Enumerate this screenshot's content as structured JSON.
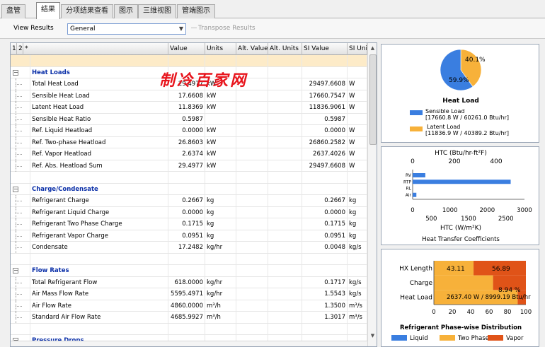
{
  "tabs": [
    {
      "label": "盘管",
      "left": 2
    },
    {
      "label": "结果",
      "left": 51,
      "active": true
    },
    {
      "label": "分项结果查看",
      "left": 86
    },
    {
      "label": "图示",
      "left": 161
    },
    {
      "label": "三维视图",
      "left": 195
    },
    {
      "label": "管端图示",
      "left": 250
    }
  ],
  "toolbar": {
    "view_label": "View Results",
    "view_value": "General",
    "transpose_label": "Transpose Results"
  },
  "grid": {
    "columns": [
      "1",
      "2",
      "*",
      "Value",
      "Units",
      "Alt. Value",
      "Alt. Units",
      "SI Value",
      "SI Uni"
    ],
    "rows": [
      {
        "type": "blank"
      },
      {
        "type": "group",
        "name": "Heat Loads"
      },
      {
        "type": "item",
        "name": "Total Heat Load",
        "value": "29.4977",
        "unit": "kW",
        "si": "29497.6608",
        "siu": "W"
      },
      {
        "type": "item",
        "name": "Sensible Heat Load",
        "value": "17.6608",
        "unit": "kW",
        "si": "17660.7547",
        "siu": "W"
      },
      {
        "type": "item",
        "name": "Latent Heat Load",
        "value": "11.8369",
        "unit": "kW",
        "si": "11836.9061",
        "siu": "W"
      },
      {
        "type": "item",
        "name": "Sensible Heat Ratio",
        "value": "0.5987",
        "unit": "",
        "si": "0.5987",
        "siu": ""
      },
      {
        "type": "item",
        "name": "Ref. Liquid Heatload",
        "value": "0.0000",
        "unit": "kW",
        "si": "0.0000",
        "siu": "W"
      },
      {
        "type": "item",
        "name": "Ref. Two-phase Heatload",
        "value": "26.8603",
        "unit": "kW",
        "si": "26860.2582",
        "siu": "W"
      },
      {
        "type": "item",
        "name": "Ref. Vapor Heatload",
        "value": "2.6374",
        "unit": "kW",
        "si": "2637.4026",
        "siu": "W"
      },
      {
        "type": "item",
        "name": "Ref. Abs. Heatload Sum",
        "value": "29.4977",
        "unit": "kW",
        "si": "29497.6608",
        "siu": "W"
      },
      {
        "type": "blank"
      },
      {
        "type": "group",
        "name": "Charge/Condensate"
      },
      {
        "type": "item",
        "name": "Refrigerant Charge",
        "value": "0.2667",
        "unit": "kg",
        "si": "0.2667",
        "siu": "kg"
      },
      {
        "type": "item",
        "name": "Refrigerant Liquid Charge",
        "value": "0.0000",
        "unit": "kg",
        "si": "0.0000",
        "siu": "kg"
      },
      {
        "type": "item",
        "name": "Refrigerant Two Phase Charge",
        "value": "0.1715",
        "unit": "kg",
        "si": "0.1715",
        "siu": "kg"
      },
      {
        "type": "item",
        "name": "Refrigerant Vapor Charge",
        "value": "0.0951",
        "unit": "kg",
        "si": "0.0951",
        "siu": "kg"
      },
      {
        "type": "item",
        "name": "Condensate",
        "value": "17.2482",
        "unit": "kg/hr",
        "si": "0.0048",
        "siu": "kg/s"
      },
      {
        "type": "blank"
      },
      {
        "type": "group",
        "name": "Flow Rates"
      },
      {
        "type": "item",
        "name": "Total Refrigerant Flow",
        "value": "618.0000",
        "unit": "kg/hr",
        "si": "0.1717",
        "siu": "kg/s"
      },
      {
        "type": "item",
        "name": "Air Mass Flow Rate",
        "value": "5595.4971",
        "unit": "kg/hr",
        "si": "1.5543",
        "siu": "kg/s"
      },
      {
        "type": "item",
        "name": "Air Flow Rate",
        "value": "4860.0000",
        "unit": "m³/h",
        "si": "1.3500",
        "siu": "m³/s"
      },
      {
        "type": "item",
        "name": "Standard Air Flow Rate",
        "value": "4685.9927",
        "unit": "m³/h",
        "si": "1.3017",
        "siu": "m³/s"
      },
      {
        "type": "blank"
      },
      {
        "type": "group",
        "name": "Pressure Drops"
      }
    ]
  },
  "watermark": "制冷百家网",
  "colors": {
    "blue": "#3a7ee0",
    "orange": "#f7b13a",
    "red": "#e05318"
  },
  "chart_data": [
    {
      "type": "pie",
      "title": "Heat Load",
      "slices": [
        {
          "name": "Sensible Load",
          "value": 59.9,
          "label": "59.9%",
          "detail": "[17660.8 W / 60261.0 Btu/hr]"
        },
        {
          "name": "Latent Load",
          "value": 40.1,
          "label": "40.1%",
          "detail": "[11836.9 W / 40389.2 Btu/hr]"
        }
      ]
    },
    {
      "type": "bar",
      "title": "Heat Transfer Coefficients",
      "top_axis_label": "HTC (Btu/hr-ft²F)",
      "top_ticks": [
        "0",
        "200",
        "400"
      ],
      "xlabel": "HTC (W/m²K)",
      "ticks_row1": [
        "0",
        "1000",
        "2000",
        "3000"
      ],
      "ticks_row2": [
        "500",
        "1500",
        "2500"
      ],
      "categories": [
        "RV",
        "RTP",
        "RL",
        "Air"
      ],
      "values": [
        340,
        2630,
        0,
        100
      ],
      "xlim": [
        0,
        3000
      ]
    },
    {
      "type": "bar",
      "title": "Refrigerant Phase-wise Distribution",
      "categories": [
        "HX Length",
        "Charge",
        "Heat Load"
      ],
      "series": [
        {
          "name": "Liquid",
          "values": [
            0,
            0,
            0
          ]
        },
        {
          "name": "Two Phase",
          "values": [
            43.11,
            64.3,
            91.06
          ]
        },
        {
          "name": "Vapor",
          "values": [
            56.89,
            35.7,
            8.94
          ]
        }
      ],
      "annotations": [
        "43.11",
        "56.89",
        "8.94 %",
        "2637.40 W / 8999.19 Btu/hr"
      ],
      "xticks": [
        "0",
        "20",
        "40",
        "60",
        "80",
        "100"
      ],
      "xlim": [
        0,
        100
      ]
    }
  ]
}
